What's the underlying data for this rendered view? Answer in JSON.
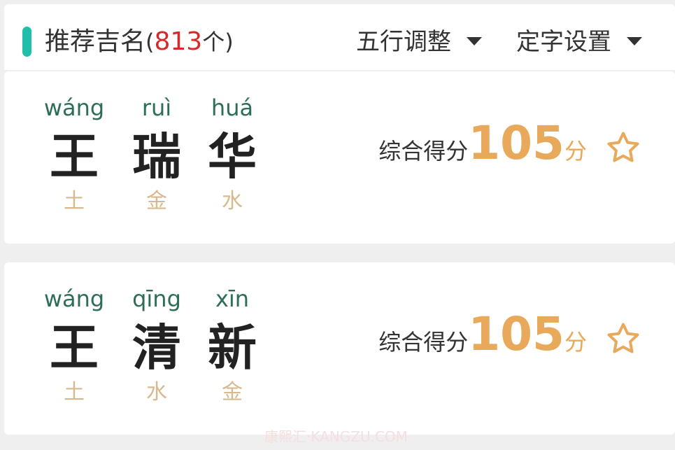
{
  "header": {
    "title": "推荐吉名",
    "count_open": "(",
    "count": "813",
    "count_unit": "个",
    "count_close": ")",
    "dropdowns": [
      {
        "label": "五行调整"
      },
      {
        "label": "定字设置"
      }
    ]
  },
  "names": [
    {
      "chars": [
        {
          "pinyin": "wáng",
          "hanzi": "王",
          "element": "土"
        },
        {
          "pinyin": "ruì",
          "hanzi": "瑞",
          "element": "金"
        },
        {
          "pinyin": "huá",
          "hanzi": "华",
          "element": "水"
        }
      ],
      "score_label": "综合得分",
      "score": "105",
      "score_unit": "分"
    },
    {
      "chars": [
        {
          "pinyin": "wáng",
          "hanzi": "王",
          "element": "土"
        },
        {
          "pinyin": "qīng",
          "hanzi": "清",
          "element": "水"
        },
        {
          "pinyin": "xīn",
          "hanzi": "新",
          "element": "金"
        }
      ],
      "score_label": "综合得分",
      "score": "105",
      "score_unit": "分"
    }
  ],
  "watermark": "康熙汇·KANGZU.COM",
  "colors": {
    "accent": "#1fbfa9",
    "count": "#d42a2a",
    "pinyin": "#2d6e5a",
    "element": "#d8b98d",
    "score": "#e8a95a"
  },
  "icons": {
    "dropdown": "caret-down-icon",
    "favorite": "star-outline-icon"
  }
}
